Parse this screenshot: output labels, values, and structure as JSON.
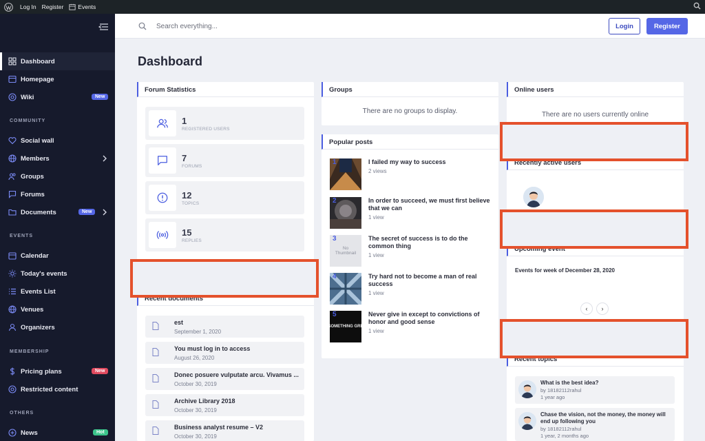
{
  "admin_bar": {
    "login": "Log In",
    "register": "Register",
    "events": "Events"
  },
  "colors": {
    "accent": "#5567e6",
    "sidebar": "#161a2c",
    "highlight": "#e4512c",
    "badge_new": "#5567e6",
    "badge_red": "#e04a5f",
    "badge_hot": "#3cc48b"
  },
  "sidebar": {
    "main": [
      {
        "label": "Dashboard",
        "icon": "grid-icon"
      },
      {
        "label": "Homepage",
        "icon": "home-icon"
      },
      {
        "label": "Wiki",
        "icon": "wiki-icon",
        "badge": "New"
      }
    ],
    "community_heading": "COMMUNITY",
    "community": [
      {
        "label": "Social wall",
        "icon": "heart-icon"
      },
      {
        "label": "Members",
        "icon": "globe-icon"
      },
      {
        "label": "Groups",
        "icon": "users-icon"
      },
      {
        "label": "Forums",
        "icon": "forum-icon"
      },
      {
        "label": "Documents",
        "icon": "folder-icon",
        "badge": "New"
      }
    ],
    "events_heading": "EVENTS",
    "events": [
      {
        "label": "Calendar",
        "icon": "calendar-icon"
      },
      {
        "label": "Today's events",
        "icon": "sun-icon"
      },
      {
        "label": "Events List",
        "icon": "list-icon"
      },
      {
        "label": "Venues",
        "icon": "building-icon"
      },
      {
        "label": "Organizers",
        "icon": "organizer-icon"
      }
    ],
    "membership_heading": "MEMBERSHIP",
    "membership": [
      {
        "label": "Pricing plans",
        "icon": "dollar-icon",
        "badge": "New"
      },
      {
        "label": "Restricted content",
        "icon": "restricted-icon"
      }
    ],
    "others_heading": "OTHERS",
    "others": [
      {
        "label": "News",
        "icon": "news-icon",
        "badge": "Hot"
      }
    ]
  },
  "topbar": {
    "search_placeholder": "Search everything...",
    "login": "Login",
    "register": "Register"
  },
  "page_title": "Dashboard",
  "forum_stats": {
    "title": "Forum Statistics",
    "items": [
      {
        "value": "1",
        "label": "REGISTERED USERS",
        "icon": "users-icon"
      },
      {
        "value": "7",
        "label": "FORUMS",
        "icon": "chat-icon"
      },
      {
        "value": "12",
        "label": "TOPICS",
        "icon": "alert-icon"
      },
      {
        "value": "15",
        "label": "REPLIES",
        "icon": "broadcast-icon"
      }
    ]
  },
  "recent_documents": {
    "title": "Recent documents",
    "items": [
      {
        "name": "est",
        "date": "September 1, 2020"
      },
      {
        "name": "You must log in to access",
        "date": "August 26, 2020"
      },
      {
        "name": "Donec posuere vulputate arcu. Vivamus ...",
        "date": "October 30, 2019"
      },
      {
        "name": "Archive Library 2018",
        "date": "October 30, 2019"
      },
      {
        "name": "Business analyst resume – V2",
        "date": "October 30, 2019"
      }
    ]
  },
  "groups": {
    "title": "Groups",
    "empty": "There are no groups to display."
  },
  "popular_posts": {
    "title": "Popular posts",
    "items": [
      {
        "num": "1",
        "title": "I failed my way to success",
        "views": "2 views"
      },
      {
        "num": "2",
        "title": "In order to succeed, we must first believe that we can",
        "views": "1 view"
      },
      {
        "num": "3",
        "title": "The secret of success is to do the common thing",
        "views": "1 view",
        "thumb_text": "No Thumbnail"
      },
      {
        "num": "4",
        "title": "Try hard not to become a man of real success",
        "views": "1 view"
      },
      {
        "num": "5",
        "title": "Never give in except to convictions of honor and good sense",
        "views": "1 view",
        "thumb_text": "SOMETHING GRE"
      }
    ]
  },
  "online_users": {
    "title": "Online users",
    "empty": "There are no users currently online"
  },
  "recently_active": {
    "title": "Recently active users"
  },
  "upcoming_event": {
    "title": "Upcoming event",
    "week": "Events for week of December 28, 2020",
    "prev": "‹",
    "next": "›"
  },
  "recent_topics": {
    "title": "Recent topics",
    "items": [
      {
        "title": "What is the best idea?",
        "by": "by 18182112rahul",
        "time": "1 year ago"
      },
      {
        "title": "Chase the vision, not the money, the money will end up following you",
        "by": "by 18182112rahul",
        "time": "1 year, 2 months ago"
      }
    ]
  }
}
